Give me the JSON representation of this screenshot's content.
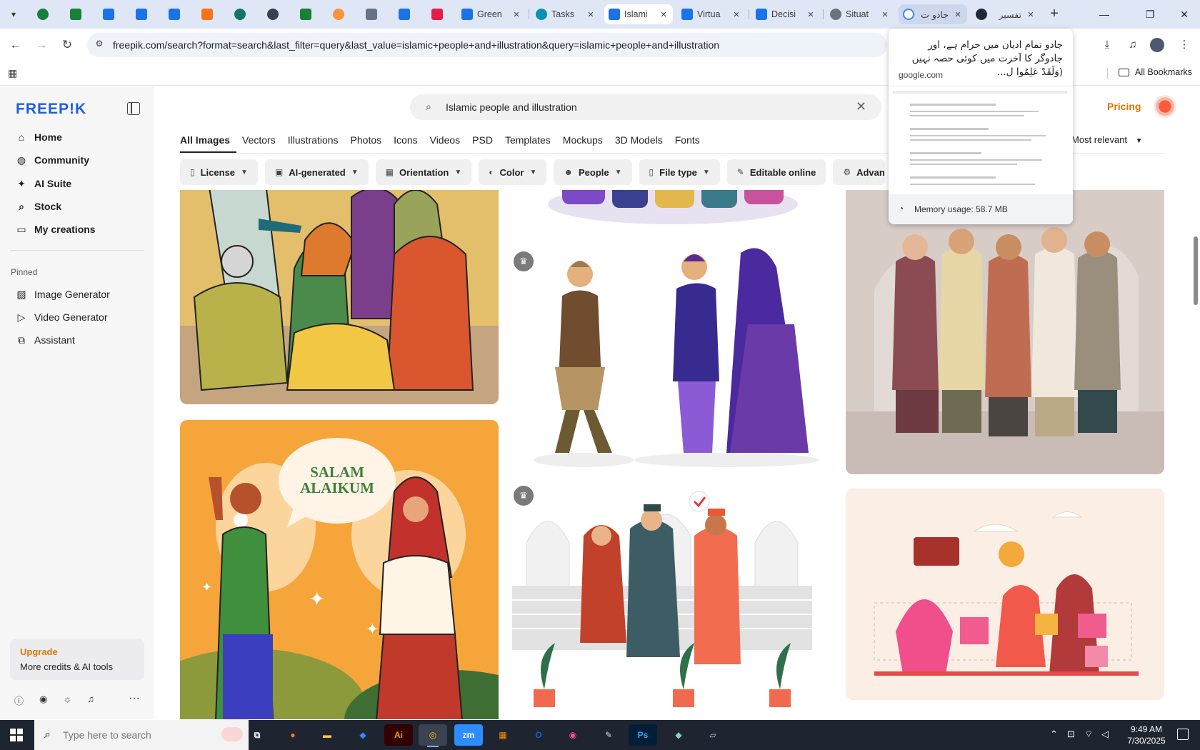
{
  "browser": {
    "tabs": [
      {
        "label": "Green",
        "icon": "docs-icon"
      },
      {
        "label": "Tasks",
        "icon": "tasks-icon"
      },
      {
        "label": "Islami",
        "icon": "freepik-icon",
        "active": true
      },
      {
        "label": "Virtua",
        "icon": "docs-icon"
      },
      {
        "label": "Decisi",
        "icon": "docs-icon"
      },
      {
        "label": "Situat",
        "icon": "globe-icon"
      },
      {
        "label": "جادو ت",
        "icon": "google-icon",
        "hover": true
      },
      {
        "label": "تفسير",
        "icon": "site-icon"
      }
    ],
    "url": "freepik.com/search?format=search&last_filter=query&last_value=islamic+people+and+illustration&query=islamic+people+and+illustration",
    "bookmarks_label": "All Bookmarks",
    "tab_popup": {
      "title": "جادو تمام ادیان میں حرام ہے، اور جادوگر کا آخرت میں کوئی حصہ نہیں (وَلَقَدْ عَلِمُوا ل...",
      "domain": "google.com",
      "memory": "Memory usage: 58.7 MB"
    }
  },
  "sidebar": {
    "logo": "FREEP!K",
    "nav": [
      {
        "label": "Home",
        "icon": "home-icon"
      },
      {
        "label": "Community",
        "icon": "globe-icon"
      },
      {
        "label": "AI Suite",
        "icon": "sparkle-icon"
      },
      {
        "label": "Stock",
        "icon": "search-icon"
      },
      {
        "label": "My creations",
        "icon": "folder-icon"
      }
    ],
    "pinned_label": "Pinned",
    "pinned": [
      {
        "label": "Image Generator",
        "icon": "image-icon"
      },
      {
        "label": "Video Generator",
        "icon": "video-icon"
      },
      {
        "label": "Assistant",
        "icon": "chat-icon"
      }
    ],
    "upgrade": {
      "title": "Upgrade",
      "subtitle": "More credits & AI tools"
    }
  },
  "header": {
    "search_value": "Islamic people and illustration",
    "pricing": "Pricing"
  },
  "type_tabs": [
    "All Images",
    "Vectors",
    "Illustrations",
    "Photos",
    "Icons",
    "Videos",
    "PSD",
    "Templates",
    "Mockups",
    "3D Models",
    "Fonts"
  ],
  "sort_label": "Most relevant",
  "filters": [
    {
      "label": "License",
      "icon": "license-icon"
    },
    {
      "label": "AI-generated",
      "icon": "ai-icon"
    },
    {
      "label": "Orientation",
      "icon": "orientation-icon"
    },
    {
      "label": "Color",
      "icon": "palette-icon"
    },
    {
      "label": "People",
      "icon": "people-icon"
    },
    {
      "label": "File type",
      "icon": "file-icon"
    },
    {
      "label": "Editable online",
      "icon": "pen-icon"
    },
    {
      "label": "Advan",
      "icon": "settings-icon"
    }
  ],
  "cards": {
    "salam_line1": "SALAM",
    "salam_line2": "ALAIKUM"
  },
  "taskbar": {
    "search_placeholder": "Type here to search",
    "time": "9:49 AM",
    "date": "7/30/2025"
  },
  "colors": {
    "brand": "#1f5ce6",
    "accent": "#d97706",
    "tabstrip": "#dfe7f6",
    "taskbar": "#1f2431"
  }
}
